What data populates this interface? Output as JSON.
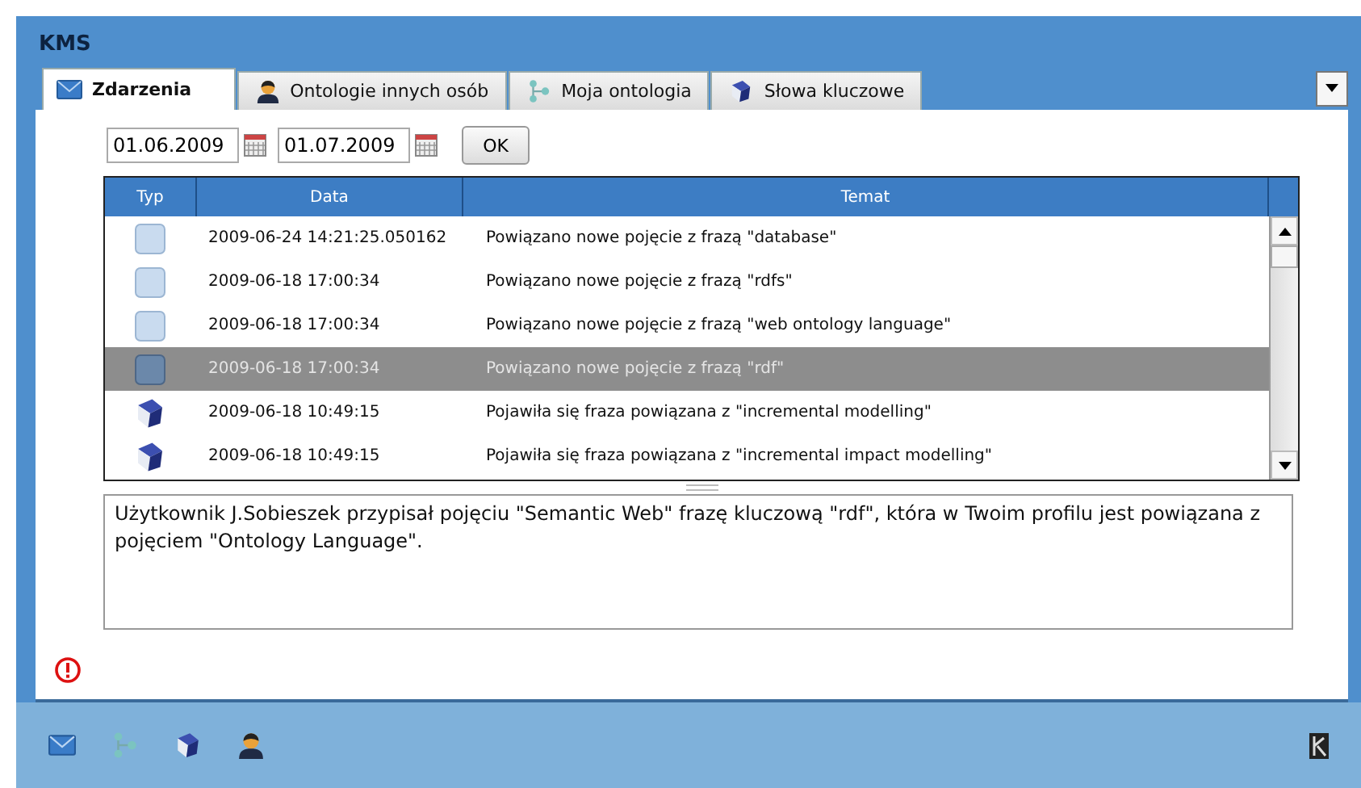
{
  "window": {
    "title": "KMS"
  },
  "tabs": [
    {
      "label": "Zdarzenia",
      "selected": true
    },
    {
      "label": "Ontologie innych osób",
      "selected": false
    },
    {
      "label": "Moja ontologia",
      "selected": false
    },
    {
      "label": "Słowa kluczowe",
      "selected": false
    }
  ],
  "filter": {
    "date_from": "01.06.2009",
    "date_to": "01.07.2009",
    "ok_button": "OK"
  },
  "table": {
    "columns": [
      "Typ",
      "Data",
      "Temat"
    ],
    "rows": [
      {
        "kind": "concept",
        "date": "2009-06-24 14:21:25.050162",
        "subject": "Powiązano nowe pojęcie z frazą \"database\"",
        "selected": false
      },
      {
        "kind": "concept",
        "date": "2009-06-18 17:00:34",
        "subject": "Powiązano nowe pojęcie z frazą \"rdfs\"",
        "selected": false
      },
      {
        "kind": "concept",
        "date": "2009-06-18 17:00:34",
        "subject": "Powiązano nowe pojęcie z frazą \"web ontology language\"",
        "selected": false
      },
      {
        "kind": "concept",
        "date": "2009-06-18 17:00:34",
        "subject": "Powiązano nowe pojęcie z frazą \"rdf\"",
        "selected": true
      },
      {
        "kind": "phrase",
        "date": "2009-06-18 10:49:15",
        "subject": "Pojawiła się fraza powiązana z \"incremental modelling\"",
        "selected": false
      },
      {
        "kind": "phrase",
        "date": "2009-06-18 10:49:15",
        "subject": "Pojawiła się fraza powiązana z \"incremental impact modelling\"",
        "selected": false
      }
    ]
  },
  "details": "Użytkownik J.Sobieszek przypisał pojęciu \"Semantic Web\" frazę kluczową \"rdf\", która w Twoim profilu jest powiązana z pojęciem \"Ontology Language\"."
}
